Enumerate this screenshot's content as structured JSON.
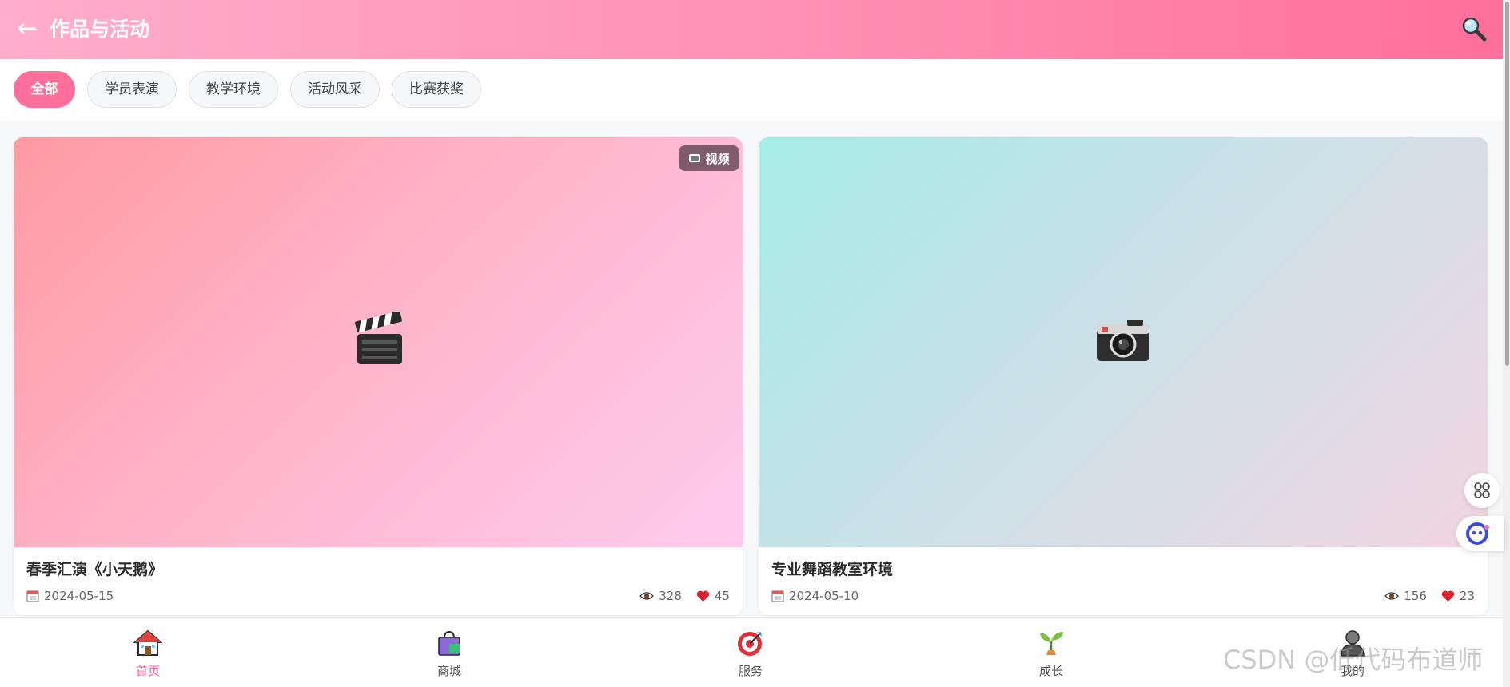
{
  "header": {
    "back_icon": "arrow-left-icon",
    "title": "作品与活动",
    "search_icon": "magnifier-icon"
  },
  "filters": [
    {
      "label": "全部",
      "active": true
    },
    {
      "label": "学员表演",
      "active": false
    },
    {
      "label": "教学环境",
      "active": false
    },
    {
      "label": "活动风采",
      "active": false
    },
    {
      "label": "比赛获奖",
      "active": false
    }
  ],
  "cards": [
    {
      "title": "春季汇演《小天鹅》",
      "date": "2024-05-15",
      "views": "328",
      "likes": "45",
      "badge": "视频",
      "media_icon": "clapper-board-icon"
    },
    {
      "title": "专业舞蹈教室环境",
      "date": "2024-05-10",
      "views": "156",
      "likes": "23",
      "media_icon": "camera-icon"
    }
  ],
  "bottom_nav": [
    {
      "label": "首页",
      "icon": "house-icon",
      "active": true
    },
    {
      "label": "商城",
      "icon": "shopping-bag-icon",
      "active": false
    },
    {
      "label": "服务",
      "icon": "target-icon",
      "active": false
    },
    {
      "label": "成长",
      "icon": "seedling-icon",
      "active": false
    },
    {
      "label": "我的",
      "icon": "person-icon",
      "active": false
    }
  ],
  "watermark": "CSDN @低代码布道师",
  "colors": {
    "accent": "#ff6f9c",
    "header_start": "#ffaecb",
    "header_end": "#ff6f9c",
    "active_nav": "#ff5a8f"
  }
}
